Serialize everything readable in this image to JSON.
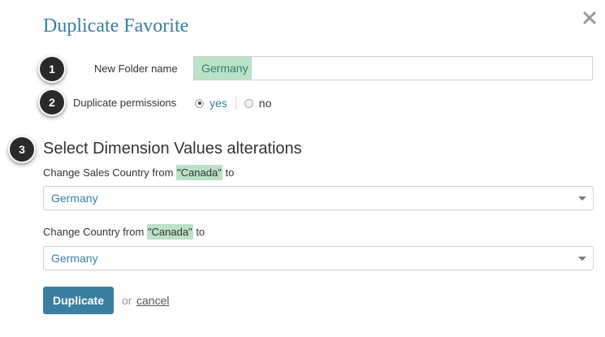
{
  "dialog": {
    "title": "Duplicate Favorite",
    "close_icon": "close-icon"
  },
  "steps": [
    "1",
    "2",
    "3"
  ],
  "folder": {
    "label": "New Folder name",
    "value": "Germany"
  },
  "permissions": {
    "label": "Duplicate permissions",
    "options": [
      {
        "label": "yes",
        "checked": true
      },
      {
        "label": "no",
        "checked": false
      }
    ]
  },
  "alterations": {
    "heading": "Select Dimension Values alterations",
    "items": [
      {
        "prefix": "Change Sales Country from",
        "from": "\"Canada\"",
        "suffix": "to",
        "selected": "Germany"
      },
      {
        "prefix": "Change Country from",
        "from": "\"Canada\"",
        "suffix": "to",
        "selected": "Germany"
      }
    ]
  },
  "actions": {
    "duplicate_label": "Duplicate",
    "or_text": "or",
    "cancel_label": "cancel"
  },
  "colors": {
    "accent": "#3a7fa0",
    "highlight": "#b9e2c6",
    "badge": "#2a2a2a"
  }
}
